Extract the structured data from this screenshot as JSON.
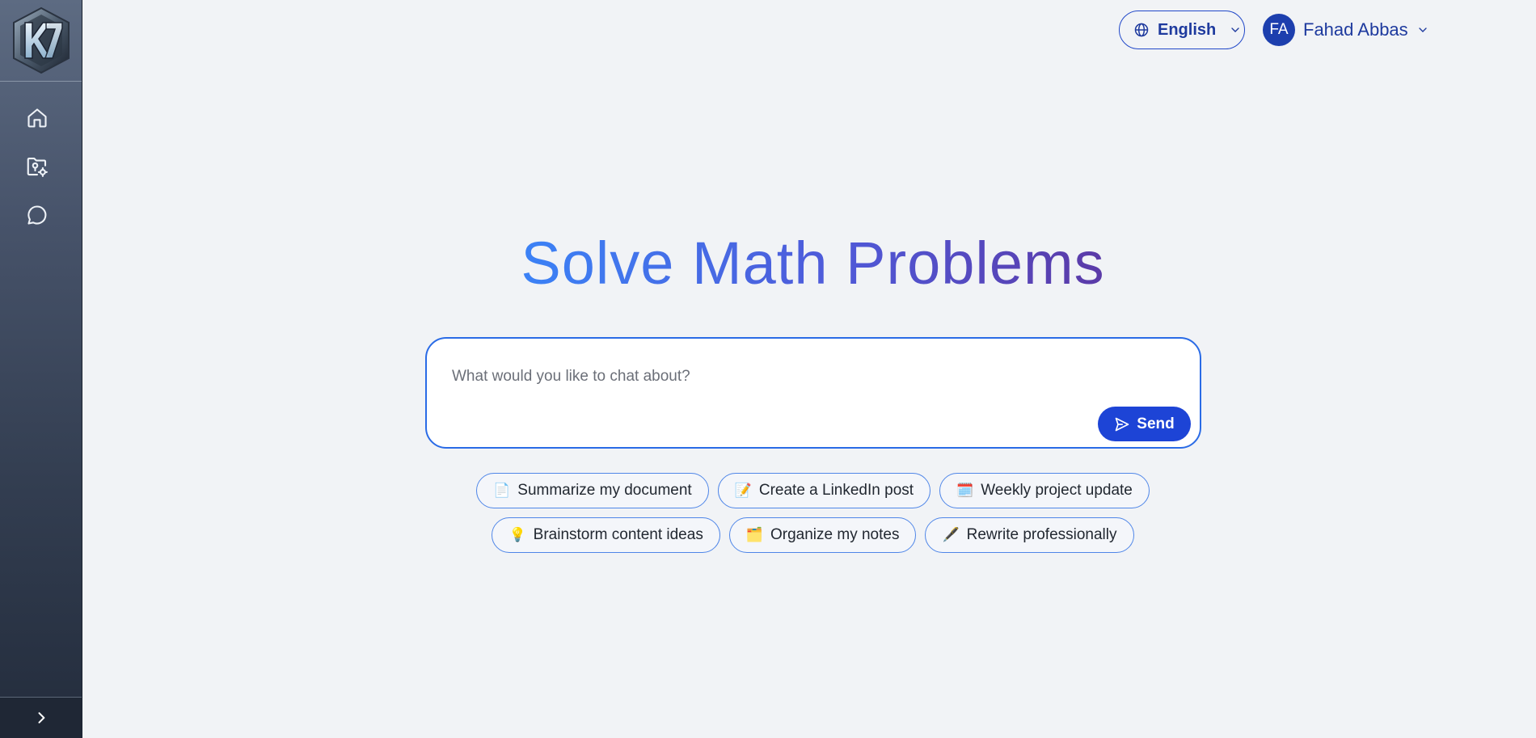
{
  "sidebar": {
    "logo_text": "K7",
    "items": [
      {
        "name": "home",
        "icon": "home-icon"
      },
      {
        "name": "folder",
        "icon": "folder-settings-icon"
      },
      {
        "name": "chat",
        "icon": "chat-bubble-icon"
      }
    ],
    "expand_icon": "chevron-right-icon"
  },
  "header": {
    "language_label": "English",
    "user_initials": "FA",
    "user_name": "Fahad Abbas"
  },
  "main": {
    "title": "Solve Math Problems",
    "chat_placeholder": "What would you like to chat about?",
    "send_label": "Send",
    "suggestions_row1": [
      {
        "emoji": "📄",
        "label": "Summarize my document"
      },
      {
        "emoji": "📝",
        "label": "Create a LinkedIn post"
      },
      {
        "emoji": "🗓️",
        "label": "Weekly project update"
      }
    ],
    "suggestions_row2": [
      {
        "emoji": "💡",
        "label": "Brainstorm content ideas"
      },
      {
        "emoji": "🗂️",
        "label": "Organize my notes"
      },
      {
        "emoji": "🖋️",
        "label": "Rewrite professionally"
      }
    ]
  },
  "colors": {
    "accent": "#1d44d6",
    "title_gradient_start": "#3b82f6",
    "title_gradient_end": "#5b3aa7",
    "background": "#f1f3f6"
  }
}
